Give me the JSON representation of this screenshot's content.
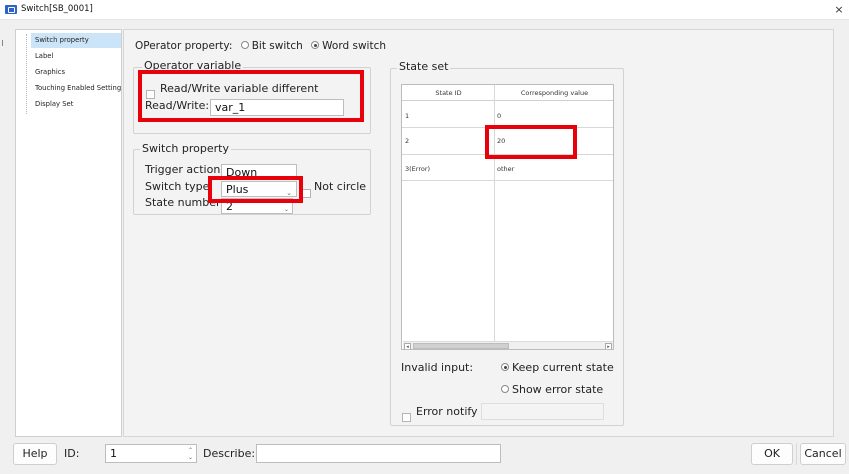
{
  "window": {
    "title": "Switch[SB_0001]",
    "close_icon": "×"
  },
  "nav": {
    "items": [
      {
        "label": "Switch property",
        "selected": true
      },
      {
        "label": "Label",
        "selected": false
      },
      {
        "label": "Graphics",
        "selected": false
      },
      {
        "label": "Touching Enabled Setting",
        "selected": false
      },
      {
        "label": "Display Set",
        "selected": false
      }
    ]
  },
  "operator": {
    "label": "OPerator property:",
    "options": [
      {
        "label": "Bit switch",
        "selected": false
      },
      {
        "label": "Word switch",
        "selected": true
      }
    ]
  },
  "operator_variable": {
    "legend": "Operator variable",
    "rw_different_label": "Read/Write variable different",
    "rw_different_checked": false,
    "rw_label": "Read/Write:",
    "rw_value": "var_1"
  },
  "switch_property": {
    "legend": "Switch property",
    "trigger_label": "Trigger action",
    "trigger_value": "Down",
    "type_label": "Switch type:",
    "type_value": "Plus",
    "not_circle_label": "Not circle",
    "not_circle_checked": false,
    "state_number_label": "State number",
    "state_number_value": "2"
  },
  "state_set": {
    "legend": "State set",
    "columns": [
      "State ID",
      "Corresponding value"
    ],
    "rows": [
      {
        "id": "1",
        "value": "0"
      },
      {
        "id": "2",
        "value": "20"
      },
      {
        "id": "3(Error)",
        "value": "other"
      }
    ],
    "scroll_left": "◂",
    "scroll_right": "▸",
    "invalid_input_label": "Invalid input:",
    "keep_label": "Keep current state",
    "keep_selected": true,
    "show_error_label": "Show error state",
    "show_error_selected": false,
    "error_notify_label": "Error notify",
    "error_notify_checked": false,
    "error_notify_value": ""
  },
  "footer": {
    "help_label": "Help",
    "id_label": "ID:",
    "id_value": "1",
    "describe_label": "Describe:",
    "describe_value": "",
    "ok_label": "OK",
    "cancel_label": "Cancel"
  },
  "colors": {
    "highlight_red": "#e8000b",
    "nav_selected": "#cce4f7",
    "app_icon": "#2b63c8"
  }
}
